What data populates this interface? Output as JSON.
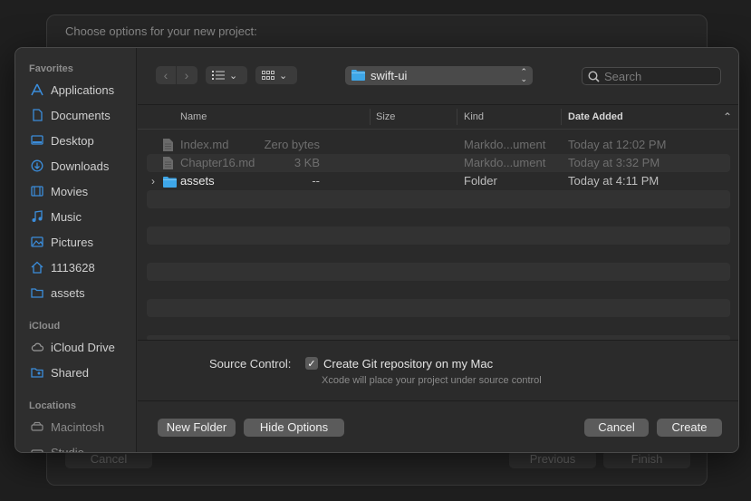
{
  "background_window": {
    "title": "Choose options for your new project:",
    "cancel_label": "Cancel",
    "previous_label": "Previous",
    "finish_label": "Finish"
  },
  "sidebar": {
    "favorites_heading": "Favorites",
    "favorites": [
      {
        "label": "Applications",
        "icon": "applications-icon"
      },
      {
        "label": "Documents",
        "icon": "document-icon"
      },
      {
        "label": "Desktop",
        "icon": "desktop-icon"
      },
      {
        "label": "Downloads",
        "icon": "downloads-icon"
      },
      {
        "label": "Movies",
        "icon": "movies-icon"
      },
      {
        "label": "Music",
        "icon": "music-icon"
      },
      {
        "label": "Pictures",
        "icon": "pictures-icon"
      },
      {
        "label": "1113628",
        "icon": "home-icon"
      },
      {
        "label": "assets",
        "icon": "folder-icon"
      }
    ],
    "icloud_heading": "iCloud",
    "icloud": [
      {
        "label": "iCloud Drive",
        "icon": "cloud-icon"
      },
      {
        "label": "Shared",
        "icon": "shared-folder-icon"
      }
    ],
    "locations_heading": "Locations",
    "locations": [
      {
        "label": "Macintosh",
        "icon": "disk-icon"
      },
      {
        "label": "Studio",
        "icon": "disk-icon"
      }
    ]
  },
  "toolbar": {
    "back_icon": "chevron-left-icon",
    "forward_icon": "chevron-right-icon",
    "list_view_icon": "list-view-icon",
    "grid_view_icon": "grid-view-icon",
    "current_folder": "swift-ui",
    "search_placeholder": "Search"
  },
  "browser": {
    "columns": {
      "name": "Name",
      "size": "Size",
      "kind": "Kind",
      "date_added": "Date Added"
    },
    "rows": [
      {
        "name": "Index.md",
        "size": "Zero bytes",
        "kind": "Markdo...ument",
        "date": "Today at 12:02 PM",
        "type": "file",
        "dimmed": true
      },
      {
        "name": "Chapter16.md",
        "size": "3 KB",
        "kind": "Markdo...ument",
        "date": "Today at 3:32 PM",
        "type": "file",
        "dimmed": true
      },
      {
        "name": "assets",
        "size": "--",
        "kind": "Folder",
        "date": "Today at 4:11 PM",
        "type": "folder",
        "dimmed": false
      }
    ]
  },
  "options": {
    "source_control_label": "Source Control:",
    "git_checkbox_label": "Create Git repository on my Mac",
    "git_checked": true,
    "git_hint": "Xcode will place your project under source control"
  },
  "buttons": {
    "new_folder": "New Folder",
    "hide_options": "Hide Options",
    "cancel": "Cancel",
    "create": "Create"
  },
  "colors": {
    "folder_blue": "#3ea6e8",
    "sidebar_icon_blue": "#3b8ddb"
  }
}
